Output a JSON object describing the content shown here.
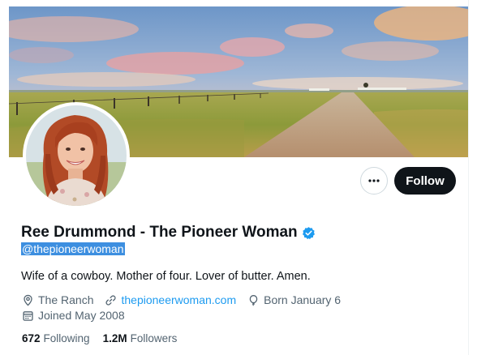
{
  "profile": {
    "name": "Ree Drummond - The Pioneer Woman",
    "handle": "@thepioneerwoman",
    "bio": "Wife of a cowboy. Mother of four. Lover of butter. Amen.",
    "location": "The Ranch",
    "website": "thepioneerwoman.com",
    "birthday": "Born January 6",
    "joined": "Joined May 2008",
    "verified_icon": "verified-badge-icon"
  },
  "actions": {
    "follow_label": "Follow",
    "more_icon": "more-horizontal-icon"
  },
  "stats": {
    "following_count": "672",
    "following_label": "Following",
    "followers_count": "1.2M",
    "followers_label": "Followers"
  },
  "colors": {
    "accent": "#1d9bf0",
    "text_primary": "#0f1419",
    "text_secondary": "#536471",
    "follow_button": "#0f1419"
  }
}
